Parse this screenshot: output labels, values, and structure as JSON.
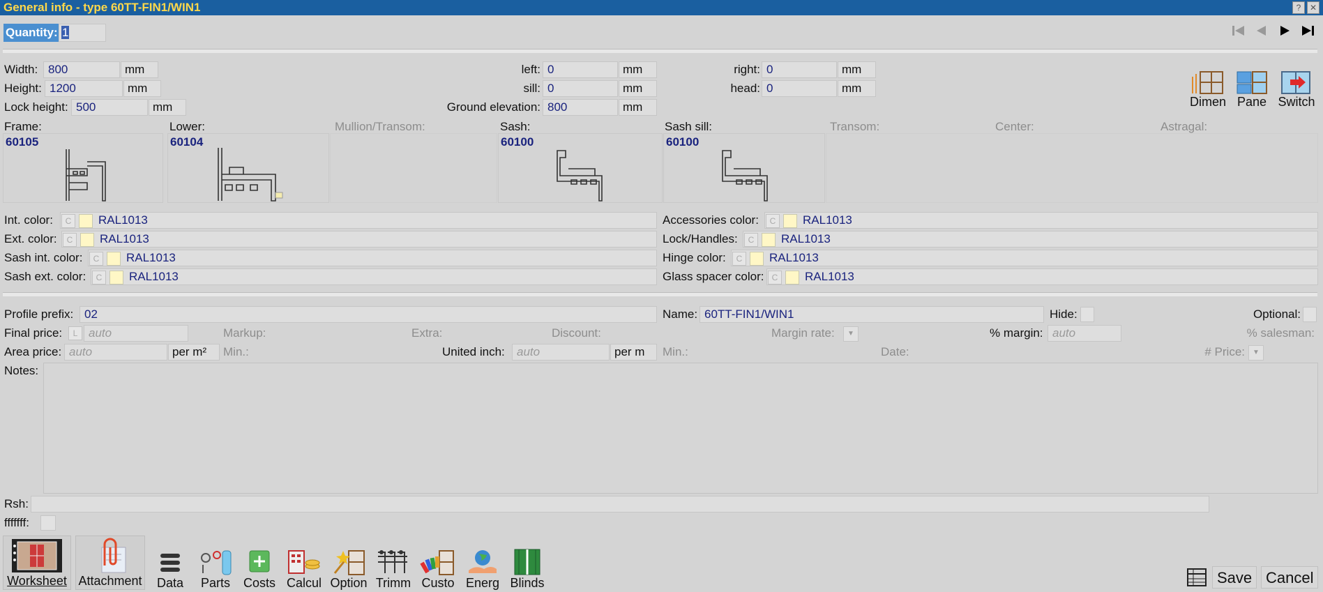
{
  "window": {
    "title": "General info - type 60TT-FIN1/WIN1",
    "help_label": "?",
    "close_label": "✕"
  },
  "quantity": {
    "label": "Quantity:",
    "value": "1"
  },
  "dims": {
    "width_label": "Width:",
    "width": "800",
    "width_unit": "mm",
    "height_label": "Height:",
    "height": "1200",
    "height_unit": "mm",
    "lock_label": "Lock height:",
    "lock": "500",
    "lock_unit": "mm",
    "left_label": "left:",
    "left": "0",
    "left_unit": "mm",
    "sill_label": "sill:",
    "sill": "0",
    "sill_unit": "mm",
    "ground_label": "Ground elevation:",
    "ground": "800",
    "ground_unit": "mm",
    "right_label": "right:",
    "right": "0",
    "right_unit": "mm",
    "head_label": "head:",
    "head": "0",
    "head_unit": "mm"
  },
  "side_buttons": {
    "dimen": "Dimen",
    "pane": "Pane",
    "switch": "Switch"
  },
  "profiles": {
    "frame_label": "Frame:",
    "frame_code": "60105",
    "lower_label": "Lower:",
    "lower_code": "60104",
    "mullion_label": "Mullion/Transom:",
    "sash_label": "Sash:",
    "sash_code": "60100",
    "sash_sill_label": "Sash sill:",
    "sash_sill_code": "60100",
    "transom_label": "Transom:",
    "center_label": "Center:",
    "astragal_label": "Astragal:"
  },
  "colors": {
    "c_label": "C",
    "swatch_color": "#fff7c6",
    "int_label": "Int. color:",
    "int_value": "RAL1013",
    "ext_label": "Ext. color:",
    "ext_value": "RAL1013",
    "sash_int_label": "Sash int. color:",
    "sash_int_value": "RAL1013",
    "sash_ext_label": "Sash ext. color:",
    "sash_ext_value": "RAL1013",
    "acc_label": "Accessories color:",
    "acc_value": "RAL1013",
    "lock_label": "Lock/Handles:",
    "lock_value": "RAL1013",
    "hinge_label": "Hinge color:",
    "hinge_value": "RAL1013",
    "spacer_label": "Glass spacer color:",
    "spacer_value": "RAL1013"
  },
  "info": {
    "prefix_label": "Profile prefix:",
    "prefix_value": "02",
    "name_label": "Name:",
    "name_value": "60TT-FIN1/WIN1",
    "hide_label": "Hide:",
    "optional_label": "Optional:",
    "final_price_label": "Final price:",
    "final_price_l": "L",
    "final_price_ph": "auto",
    "markup_label": "Markup:",
    "extra_label": "Extra:",
    "discount_label": "Discount:",
    "margin_rate_label": "Margin rate:",
    "pct_margin_label": "% margin:",
    "pct_margin_ph": "auto",
    "pct_salesman_label": "% salesman:",
    "area_price_label": "Area price:",
    "area_price_ph": "auto",
    "area_unit": "per m²",
    "min1_label": "Min.:",
    "united_inch_label": "United inch:",
    "united_inch_ph": "auto",
    "united_unit": "per m",
    "min2_label": "Min.:",
    "date_label": "Date:",
    "num_price_label": "# Price:",
    "notes_label": "Notes:",
    "rsh_label": "Rsh:",
    "fff_label": "fffffff:"
  },
  "toolbar": {
    "worksheet": "Worksheet",
    "attachment": "Attachment",
    "data": "Data",
    "parts": "Parts",
    "costs": "Costs",
    "calcul": "Calcul",
    "option": "Option",
    "trimm": "Trimm",
    "custo": "Custo",
    "energ": "Energ",
    "blinds": "Blinds",
    "save": "Save",
    "cancel": "Cancel"
  }
}
